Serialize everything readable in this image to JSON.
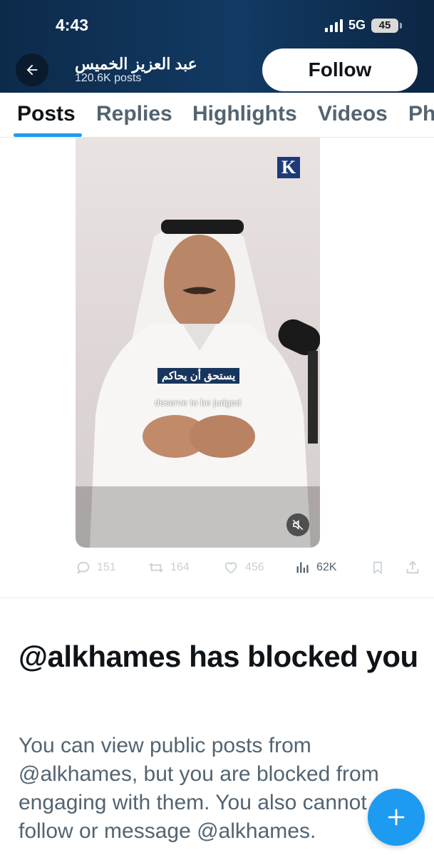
{
  "status_bar": {
    "time": "4:43",
    "network": "5G",
    "battery": "45"
  },
  "profile": {
    "name": "عبد العزيز الخميس",
    "posts_count": "120.6K posts",
    "follow_label": "Follow"
  },
  "tabs": [
    {
      "label": "Posts",
      "active": true
    },
    {
      "label": "Replies"
    },
    {
      "label": "Highlights"
    },
    {
      "label": "Videos"
    },
    {
      "label": "Ph"
    }
  ],
  "video": {
    "logo_letter": "K",
    "caption_arabic": "يستحق أن يحاكم",
    "caption_english": "deserve to be judged"
  },
  "post_actions": {
    "replies": "151",
    "reposts": "164",
    "likes": "456",
    "views": "62K"
  },
  "blocked": {
    "title": "@alkhames has blocked you",
    "description": "You can view public posts from @alkhames, but you are blocked from engaging with them. You also cannot follow or message @alkhames."
  },
  "colors": {
    "accent": "#1d9bf0",
    "header_bg": "#123a63",
    "text_primary": "#0f1419",
    "text_secondary": "#536471"
  }
}
